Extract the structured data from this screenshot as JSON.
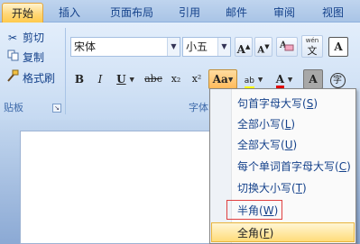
{
  "tabs": [
    {
      "label": "开始",
      "active": true
    },
    {
      "label": "插入",
      "active": false
    },
    {
      "label": "页面布局",
      "active": false
    },
    {
      "label": "引用",
      "active": false
    },
    {
      "label": "邮件",
      "active": false
    },
    {
      "label": "审阅",
      "active": false
    },
    {
      "label": "视图",
      "active": false
    }
  ],
  "clipboard": {
    "cut_label": "剪切",
    "copy_label": "复制",
    "format_painter_label": "格式刷",
    "group_label": "贴板"
  },
  "font": {
    "name_value": "宋体",
    "size_value": "小五",
    "group_label": "字体",
    "grow_label": "A",
    "shrink_label": "A",
    "clear_label": "A",
    "phonetic_label": "wén",
    "phonetic_char": "文",
    "border_label": "A",
    "bold_label": "B",
    "italic_label": "I",
    "underline_label": "U",
    "strike_label": "abc",
    "subscript_label": "x₂",
    "superscript_label": "x²",
    "change_case_label": "Aa",
    "highlight_label": "ab",
    "color_label": "A",
    "shading_label": "A",
    "enclose_label": "字"
  },
  "colors": {
    "accent": "#ffbb5b",
    "highlight": "#ffff00",
    "font_color": "#e00000",
    "half_outline": "#e04040"
  },
  "change_case_menu": {
    "items": [
      {
        "label": "句首字母大写(",
        "key": "S",
        "close": ")"
      },
      {
        "label": "全部小写(",
        "key": "L",
        "close": ")"
      },
      {
        "label": "全部大写(",
        "key": "U",
        "close": ")"
      },
      {
        "label": "每个单词首字母大写(",
        "key": "C",
        "close": ")"
      },
      {
        "label": "切换大小写(",
        "key": "T",
        "close": ")"
      },
      {
        "label": "半角(",
        "key": "W",
        "close": ")"
      },
      {
        "label": "全角(",
        "key": "F",
        "close": ")"
      }
    ]
  }
}
